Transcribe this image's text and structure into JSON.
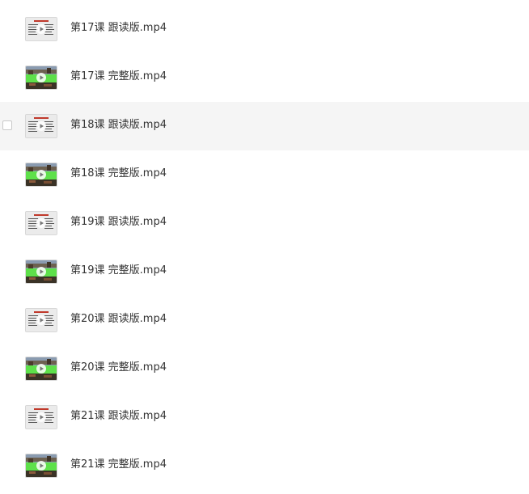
{
  "files": [
    {
      "name": "第17课 跟读版.mp4",
      "thumb": "slide",
      "hover": false
    },
    {
      "name": "第17课 完整版.mp4",
      "thumb": "video",
      "hover": false
    },
    {
      "name": "第18课 跟读版.mp4",
      "thumb": "slide",
      "hover": true
    },
    {
      "name": "第18课 完整版.mp4",
      "thumb": "video",
      "hover": false
    },
    {
      "name": "第19课 跟读版.mp4",
      "thumb": "slide",
      "hover": false
    },
    {
      "name": "第19课 完整版.mp4",
      "thumb": "video",
      "hover": false
    },
    {
      "name": "第20课 跟读版.mp4",
      "thumb": "slide",
      "hover": false
    },
    {
      "name": "第20课 完整版.mp4",
      "thumb": "video",
      "hover": false
    },
    {
      "name": "第21课 跟读版.mp4",
      "thumb": "slide",
      "hover": false
    },
    {
      "name": "第21课 完整版.mp4",
      "thumb": "video",
      "hover": false
    }
  ],
  "colors": {
    "hover_bg": "#f5f5f5",
    "text": "#333333",
    "video_sky": "#8a9bb0",
    "video_band": "#5ee04a",
    "video_ground": "#3a3226",
    "slide_title": "#c0392b"
  },
  "icons": {
    "play": "play-icon",
    "checkbox": "checkbox-icon"
  }
}
